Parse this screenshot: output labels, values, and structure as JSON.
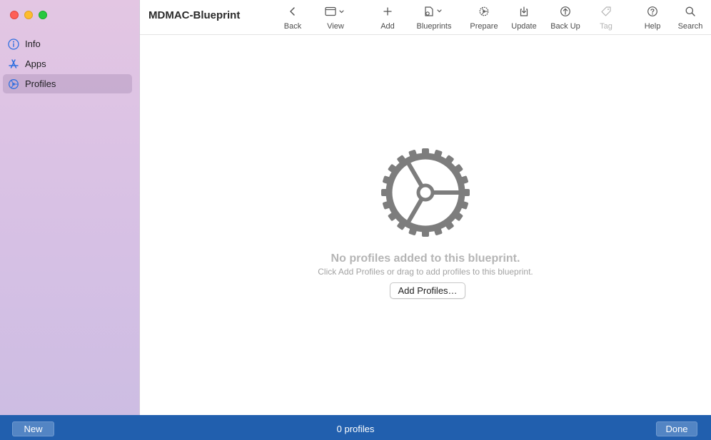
{
  "window": {
    "title": "MDMAC-Blueprint"
  },
  "sidebar": {
    "items": [
      {
        "label": "Info",
        "icon": "info-icon"
      },
      {
        "label": "Apps",
        "icon": "apps-icon"
      },
      {
        "label": "Profiles",
        "icon": "profiles-icon",
        "selected": true
      }
    ]
  },
  "toolbar": {
    "back": "Back",
    "view": "View",
    "add": "Add",
    "blueprints": "Blueprints",
    "prepare": "Prepare",
    "update": "Update",
    "backup": "Back Up",
    "tag": "Tag",
    "help": "Help",
    "search": "Search"
  },
  "main": {
    "empty_title": "No profiles added to this blueprint.",
    "empty_subtitle": "Click Add Profiles or drag to add profiles to this blueprint.",
    "add_profiles_button": "Add Profiles…"
  },
  "bottom_bar": {
    "new_button": "New",
    "count": "0 profiles",
    "done_button": "Done"
  },
  "colors": {
    "accent": "#215fae",
    "sidebar_icon": "#2f6fe0",
    "gear": "#7d7d7d"
  }
}
